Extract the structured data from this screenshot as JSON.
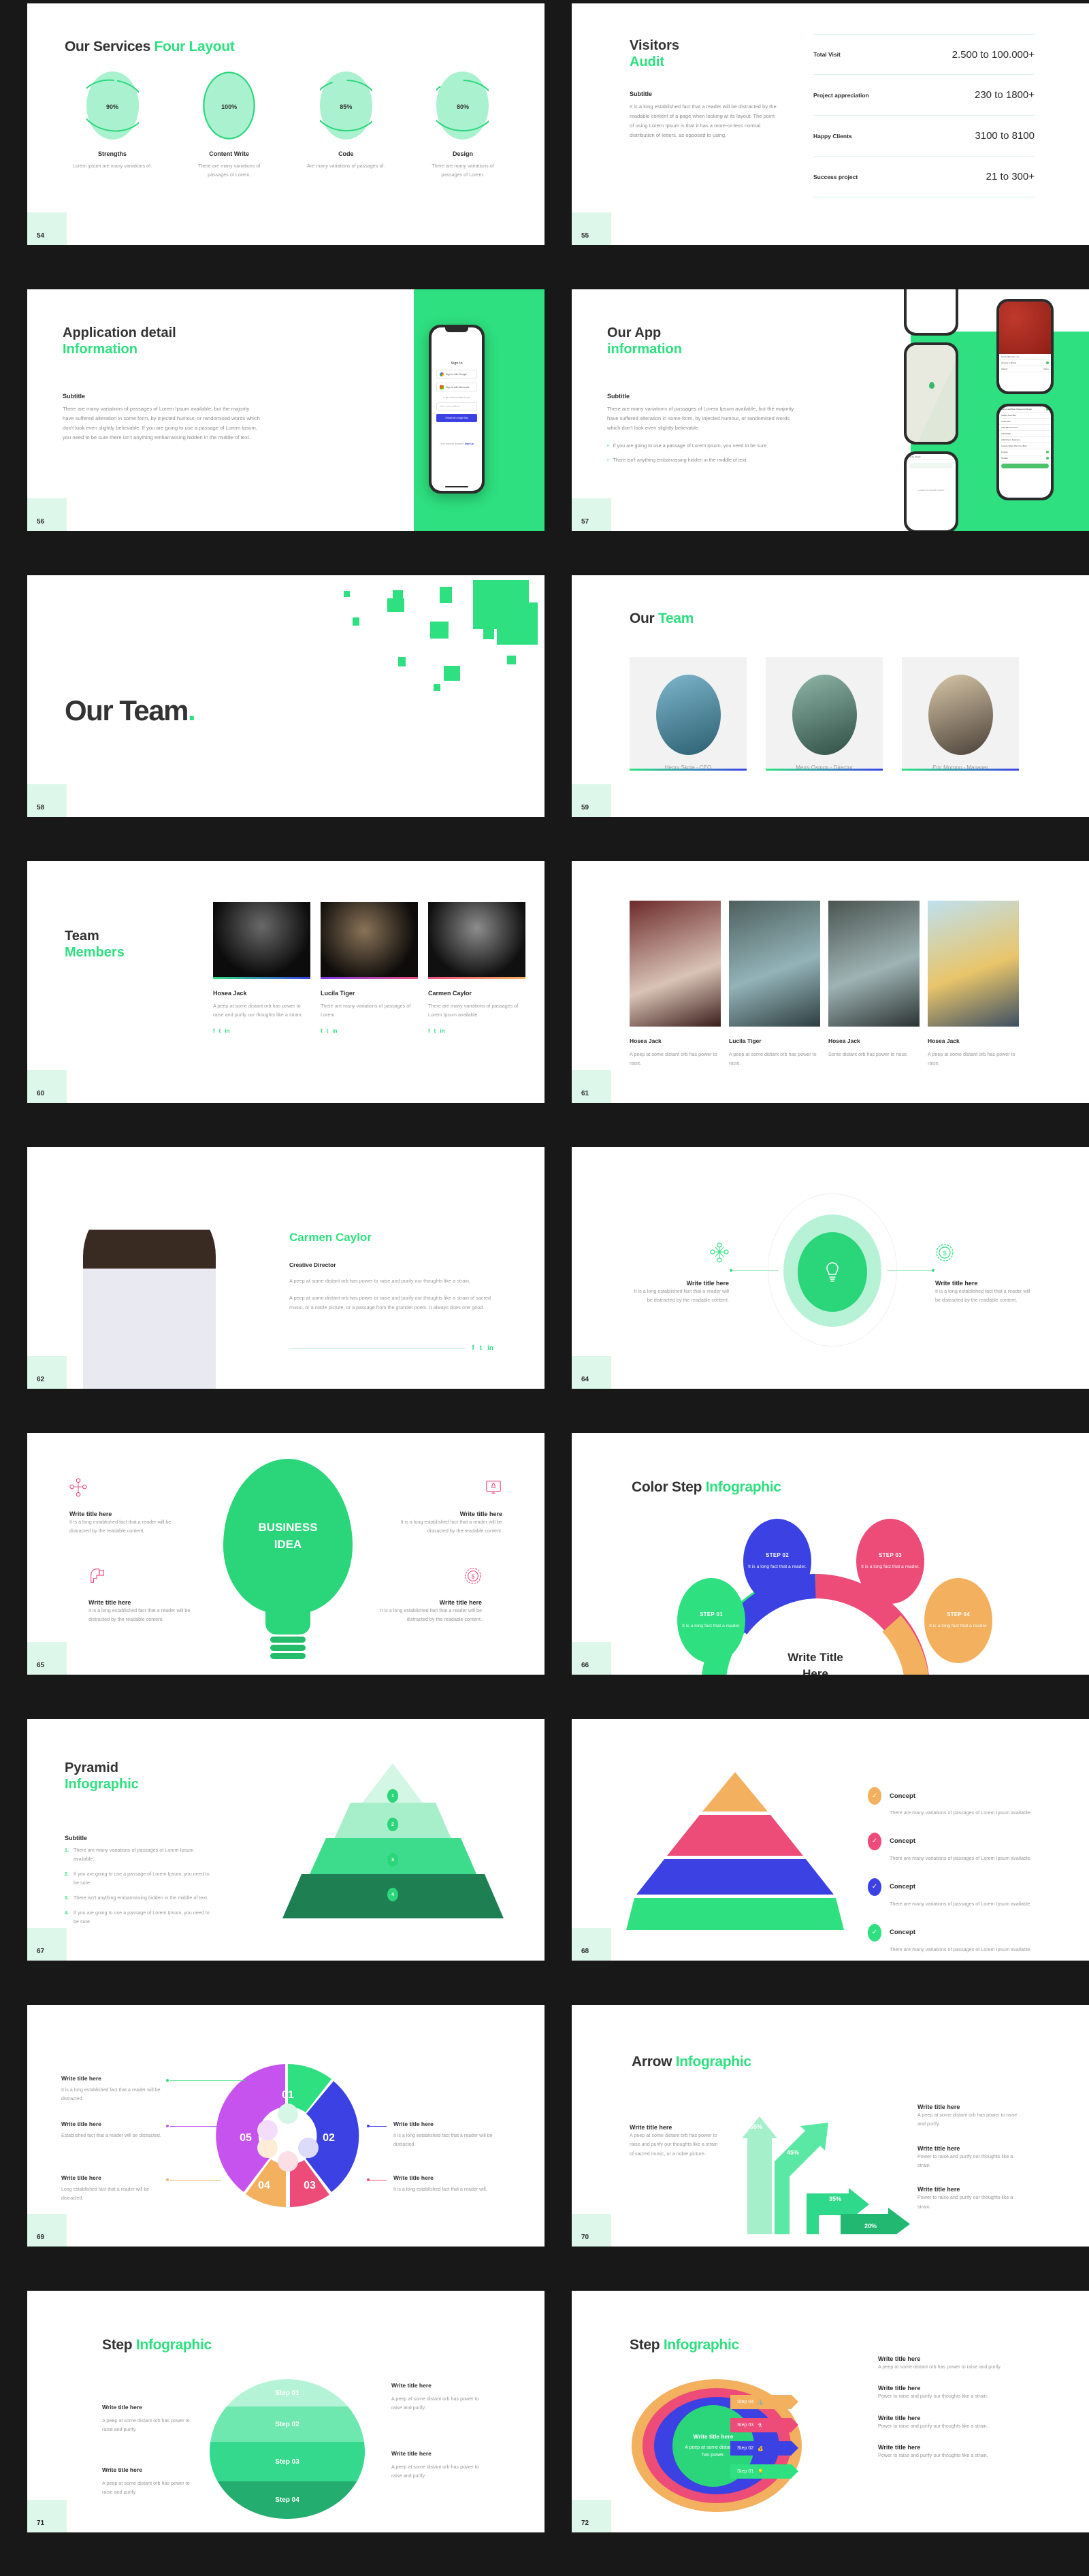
{
  "theme": {
    "accent": "#2ee07f",
    "dark": "#333333",
    "bg": "#181818",
    "badge_bg": "#ddf7ea"
  },
  "slides": [
    {
      "page": "54",
      "title_dark": "Our Services ",
      "title_accent": "Four Layout",
      "items": [
        {
          "pct": "90",
          "unit": "%",
          "name": "Strengths",
          "desc": "Lorem ipsum are many variations of."
        },
        {
          "pct": "100",
          "unit": "%",
          "name": "Content Write",
          "desc": "There are many variations of passages of Lorem."
        },
        {
          "pct": "85",
          "unit": "%",
          "name": "Code",
          "desc": "Are many variations of passages of."
        },
        {
          "pct": "80",
          "unit": "%",
          "name": "Design",
          "desc": "There are many variations of passages of Lorem."
        }
      ]
    },
    {
      "page": "55",
      "title_dark": "Visitors",
      "title_accent": "Audit",
      "sub_heading": "Subtitle",
      "sub_body": "It is a long established fact that a reader will be distracted by the readable content of a page when looking at its layout. The point of using Lorem Ipsum is that it has a more-or-less normal distribution of letters, as opposed to using.",
      "rows": [
        {
          "label": "Total Visit",
          "value": "2.500 to 100.000+"
        },
        {
          "label": "Project appreciation",
          "value": "230 to 1800+"
        },
        {
          "label": "Happy Clients",
          "value": "3100 to 8100"
        },
        {
          "label": "Success project",
          "value": "21 to 300+"
        }
      ]
    },
    {
      "page": "56",
      "title_dark": "Application detail",
      "title_accent": "Information",
      "sub_heading": "Subtitle",
      "sub_body": "There are many variations of passages of Lorem Ipsum available, but the majority have suffered alteration in some form, by injected humour, or randomised words which don't look even slightly believable. If you are going to use a passage of Lorem Ipsum, you need to be sure there isn't anything embarrassing hidden in the middle of text.",
      "phone": {
        "sign_in": "Sign In",
        "google": "Sign in with Google",
        "microsoft": "Sign in with Microsoft",
        "or_line": "or get a link emailed to you",
        "email_placeholder": "Work email address",
        "cta": "Email me a login link",
        "footer": "Don't have an account? ",
        "footer_link": "Sign Up"
      }
    },
    {
      "page": "57",
      "title_dark": "Our App",
      "title_accent": "information",
      "sub_heading": "Subtitle",
      "sub_body": "There are many variations of passages of Lorem Ipsum available, but the majority have suffered alteration in some form, by injected humour, or randomised words which don't look even slightly believable.",
      "bullets": [
        "If you are going to use a passage of Lorem Ipsum, you need to be sure",
        "There isn't anything embarrassing hidden in the middle of text."
      ]
    },
    {
      "page": "58",
      "big_title": "Our Team",
      "big_dot": "."
    },
    {
      "page": "59",
      "title_dark": "Our ",
      "title_accent": "Team",
      "members": [
        {
          "name": "Henry Skote",
          "sep": " - ",
          "role": "CEO"
        },
        {
          "name": "Merry Osmon",
          "sep": " - ",
          "role": "Director"
        },
        {
          "name": "Eric Morgon",
          "sep": " - ",
          "role": "Manager"
        }
      ]
    },
    {
      "page": "60",
      "title_dark": "Team",
      "title_accent": "Members",
      "members": [
        {
          "name": "Hosea Jack",
          "desc": "A peep at some distant orb has power to raise and purify our thoughts like a strain.",
          "bar": "linear-gradient(90deg,#2ee07f,#3b41e3)"
        },
        {
          "name": "Lucila Tiger",
          "desc": "There are many variations of passages of Lorem.",
          "bar": "linear-gradient(90deg,#7c3aed,#ef4f7e)"
        },
        {
          "name": "Carmen Caylor",
          "desc": "There are many variations of passages of Lorem Ipsum available.",
          "bar": "linear-gradient(90deg,#ef4f7e,#f5b25c)"
        }
      ],
      "social": [
        "f",
        "t",
        "in"
      ]
    },
    {
      "page": "61",
      "members": [
        {
          "name": "Hosea Jack",
          "desc": "A peep at some distant orb has power to raise."
        },
        {
          "name": "Lucila Tiger",
          "desc": "A peep at some distant orb has power to raise."
        },
        {
          "name": "Hosea Jack",
          "desc": "Some distant orb has power to raise."
        },
        {
          "name": "Hosea Jack",
          "desc": "A peep at some distant orb has power to raise."
        }
      ]
    },
    {
      "page": "62",
      "name": "Carmen Caylor",
      "role": "Creative Director",
      "p1": "A peep at some distant orb has power to raise and purify our thoughts like a strain.",
      "p2": "A peep at some distant orb has power to raise and purify our thoughts like a strain of sacred music, or a noble picture, or a passage from the grander poets. It always does one good.",
      "social": [
        "f",
        "t",
        "in"
      ]
    },
    {
      "page": "64",
      "left": {
        "title": "Write title here",
        "body": "It is a long established fact that a reader will be distracted by the readable content."
      },
      "right": {
        "title": "Write title here",
        "body": "It is a long established fact that a reader will be distracted by the readable content."
      },
      "center_icon": "lightbulb-icon"
    },
    {
      "page": "65",
      "bulb_line1": "BUSINESS",
      "bulb_line2": "IDEA",
      "quadrants": [
        {
          "title": "Write title here",
          "body": "It is a long established fact that a reader will be distracted by the readable content.",
          "icon": "network-icon"
        },
        {
          "title": "Write title here",
          "body": "It is a long established fact that a reader will be distracted by the readable content.",
          "icon": "rocket-launch-icon"
        },
        {
          "title": "Write title here",
          "body": "It is a long established fact that a reader will be distracted by the readable content.",
          "icon": "head-idea-icon"
        },
        {
          "title": "Write title here",
          "body": "It is a long established fact that a reader will be distracted by the readable content.",
          "icon": "money-badge-icon"
        }
      ]
    },
    {
      "page": "66",
      "title_dark": "Color Step ",
      "title_accent": "Infographic",
      "center_title_1": "Write Title",
      "center_title_2": "Here",
      "steps": [
        {
          "label": "STEP 01",
          "body": "It is a long fact that a reader.",
          "color": "#2ee07f"
        },
        {
          "label": "STEP 02",
          "body": "It is a long fact that a reader.",
          "color": "#3b41e3"
        },
        {
          "label": "STEP 03",
          "body": "It is a long fact that a reader.",
          "color": "#ed4b78"
        },
        {
          "label": "STEP 04",
          "body": "It is a long fact that a reader.",
          "color": "#f3b05e"
        }
      ]
    },
    {
      "page": "67",
      "title_dark": "Pyramid",
      "title_accent": "Infographic",
      "sub_heading": "Subtitle",
      "items": [
        {
          "n": "1.",
          "text": "There are many variations of passages of Lorem Ipsum available,"
        },
        {
          "n": "2.",
          "text": "If you are going to use a passage of Lorem Ipsum, you need to be sure"
        },
        {
          "n": "3.",
          "text": "There isn't anything embarrassing hidden in the middle of text."
        },
        {
          "n": "4.",
          "text": "If you are going to use a passage of Lorem Ipsum, you need to be sure"
        }
      ],
      "levels": [
        "1",
        "2",
        "3",
        "4"
      ]
    },
    {
      "page": "68",
      "concepts": [
        {
          "title": "Concept",
          "body": "There are many variations of passages of Lorem Ipsum available.",
          "color": "#f3b05e"
        },
        {
          "title": "Concept",
          "body": "There are many variations of passages of Lorem Ipsum available.",
          "color": "#ed4b78"
        },
        {
          "title": "Concept",
          "body": "There are many variations of passages of Lorem Ipsum available.",
          "color": "#3b41e3"
        },
        {
          "title": "Concept",
          "body": "There are many variations of passages of Lorem Ipsum available.",
          "color": "#2ee07f"
        }
      ]
    },
    {
      "page": "69",
      "segments": [
        {
          "num": "01",
          "color": "#2ee07f",
          "title": "Write title here",
          "body": "It is a long established fact that a reader will be distracted."
        },
        {
          "num": "02",
          "color": "#3b41e3",
          "title": "Write title here",
          "body": "It is a long established fact that a reader will be distracted."
        },
        {
          "num": "03",
          "color": "#ed4b78",
          "title": "Write title here",
          "body": "It is a long established fact that a reader will."
        },
        {
          "num": "04",
          "color": "#f3b05e",
          "title": "Write title here",
          "body": "Long established fact that a reader will be distracted."
        },
        {
          "num": "05",
          "color": "#c653ee",
          "title": "Write title here",
          "body": "Established fact that a reader will be distracted."
        }
      ]
    },
    {
      "page": "70",
      "title_dark": "Arrow ",
      "title_accent": "Infographic",
      "left": {
        "title": "Write title here",
        "body": "A peep at some distant orb has power to raise and purify our thoughts like a strain of sacred music, or a noble picture."
      },
      "values": [
        "55%",
        "45%",
        "35%",
        "20%"
      ],
      "right": [
        {
          "title": "Write title here",
          "body": "A peep at some distant orb has power to raise and purify."
        },
        {
          "title": "Write title here",
          "body": "Power to raise and purify our thoughts like a strain."
        },
        {
          "title": "Write title here",
          "body": "Power to raise and purify our thoughts like a strain."
        }
      ]
    },
    {
      "page": "71",
      "title_dark": "Step ",
      "title_accent": "Infographic",
      "steps": [
        "Step 01",
        "Step 02",
        "Step 03",
        "Step 04"
      ],
      "callouts": [
        {
          "title": "Write title here",
          "body": "A peep at some distant orb has power to raise and purify."
        },
        {
          "title": "Write title here",
          "body": "A peep at some distant orb has power to raise and purify."
        },
        {
          "title": "Write title here",
          "body": "A peep at some distant orb has power to raise and purify."
        },
        {
          "title": "Write title here",
          "body": "A peep at some distant orb has power to raise and purify."
        }
      ]
    },
    {
      "page": "72",
      "title_dark": "Step ",
      "title_accent": "Infographic",
      "center_title": "Write title here",
      "center_body": "A peep at some distant orb has power.",
      "tags": [
        {
          "label": "Step  04",
          "color": "#f3b05e",
          "icon": "anchor-icon"
        },
        {
          "label": "Step  03",
          "color": "#ed4b78",
          "icon": "flask-icon"
        },
        {
          "label": "Step  02",
          "color": "#3b41e3",
          "icon": "money-bag-icon"
        },
        {
          "label": "Step  01",
          "color": "#2ee07f",
          "icon": "lightbulb-icon"
        }
      ],
      "right": [
        {
          "title": "Write title here",
          "body": "A peep at some distant orb has power to raise and purify."
        },
        {
          "title": "Write title here",
          "body": "Power to raise and purify our thoughts like a strain."
        },
        {
          "title": "Write title here",
          "body": "Power to raise and purify our thoughts like a strain."
        },
        {
          "title": "Write title here",
          "body": "Power to raise and purify our thoughts like a strain."
        }
      ]
    }
  ]
}
